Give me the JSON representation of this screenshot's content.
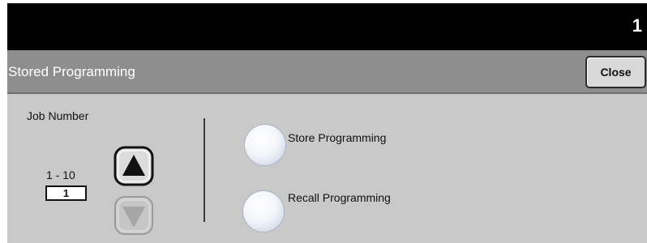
{
  "header": {
    "page_number": "1"
  },
  "titlebar": {
    "title": "Stored Programming",
    "close_label": "Close"
  },
  "job_number": {
    "label": "Job Number",
    "range": "1 - 10",
    "value": "1",
    "up_icon": "arrow-up-icon",
    "down_icon": "arrow-down-icon",
    "down_enabled": false
  },
  "options": [
    {
      "label": "Store Programming",
      "selected": false
    },
    {
      "label": "Recall Programming",
      "selected": false
    }
  ]
}
